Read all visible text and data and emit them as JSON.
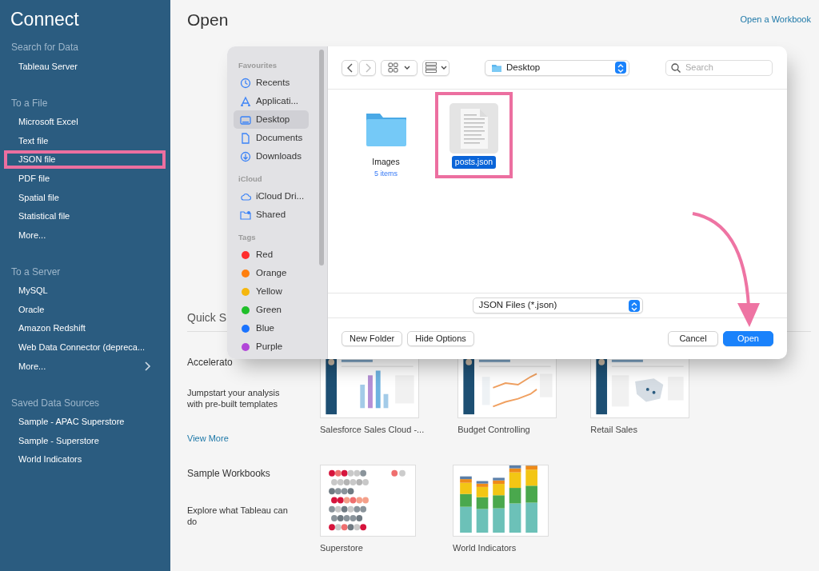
{
  "sidebar": {
    "title": "Connect",
    "sections": [
      {
        "heading": "Search for Data",
        "items": [
          {
            "label": "Tableau Server",
            "highlighted": false,
            "submenu": false
          }
        ]
      },
      {
        "heading": "To a File",
        "items": [
          {
            "label": "Microsoft Excel",
            "highlighted": false,
            "submenu": false
          },
          {
            "label": "Text file",
            "highlighted": false,
            "submenu": false
          },
          {
            "label": "JSON file",
            "highlighted": true,
            "submenu": false
          },
          {
            "label": "PDF file",
            "highlighted": false,
            "submenu": false
          },
          {
            "label": "Spatial file",
            "highlighted": false,
            "submenu": false
          },
          {
            "label": "Statistical file",
            "highlighted": false,
            "submenu": false
          },
          {
            "label": "More...",
            "highlighted": false,
            "submenu": false
          }
        ]
      },
      {
        "heading": "To a Server",
        "items": [
          {
            "label": "MySQL",
            "highlighted": false,
            "submenu": false
          },
          {
            "label": "Oracle",
            "highlighted": false,
            "submenu": false
          },
          {
            "label": "Amazon Redshift",
            "highlighted": false,
            "submenu": false
          },
          {
            "label": "Web Data Connector (depreca...",
            "highlighted": false,
            "submenu": false
          },
          {
            "label": "More...",
            "highlighted": false,
            "submenu": true
          }
        ]
      },
      {
        "heading": "Saved Data Sources",
        "items": [
          {
            "label": "Sample - APAC Superstore",
            "highlighted": false,
            "submenu": false
          },
          {
            "label": "Sample - Superstore",
            "highlighted": false,
            "submenu": false
          },
          {
            "label": "World Indicators",
            "highlighted": false,
            "submenu": false
          }
        ]
      }
    ]
  },
  "main": {
    "title": "Open",
    "link": "Open a Workbook",
    "quick_start_heading": "Quick S",
    "accelerators": {
      "heading": "Accelerato",
      "description": "Jumpstart your analysis with pre-built templates",
      "link": "View More",
      "items": [
        {
          "label": "Salesforce Sales Cloud -...",
          "kind": "picture"
        },
        {
          "label": "Budget Controlling",
          "kind": "picture"
        },
        {
          "label": "Retail Sales",
          "kind": "picture"
        }
      ]
    },
    "samples": {
      "heading": "Sample Workbooks",
      "description": "Explore what Tableau can do",
      "items": [
        {
          "label": "Superstore",
          "kind": "dot_plot"
        },
        {
          "label": "World Indicators",
          "kind": "stacked_bars"
        }
      ]
    }
  },
  "dialog": {
    "sidebar": {
      "sections": [
        {
          "heading": "Favourites",
          "items": [
            {
              "label": "Recents",
              "kind": "recents",
              "selected": false
            },
            {
              "label": "Applicati...",
              "kind": "applications",
              "selected": false
            },
            {
              "label": "Desktop",
              "kind": "desktop",
              "selected": true
            },
            {
              "label": "Documents",
              "kind": "documents",
              "selected": false
            },
            {
              "label": "Downloads",
              "kind": "downloads",
              "selected": false
            }
          ]
        },
        {
          "heading": "iCloud",
          "items": [
            {
              "label": "iCloud Dri...",
              "kind": "icloud",
              "selected": false
            },
            {
              "label": "Shared",
              "kind": "shared",
              "selected": false
            }
          ]
        },
        {
          "heading": "Tags",
          "items": [
            {
              "label": "Red",
              "kind": "tag",
              "selected": false,
              "color": "#ff2d2d"
            },
            {
              "label": "Orange",
              "kind": "tag",
              "selected": false,
              "color": "#ff7f0f"
            },
            {
              "label": "Yellow",
              "kind": "tag",
              "selected": false,
              "color": "#f5b70f"
            },
            {
              "label": "Green",
              "kind": "tag",
              "selected": false,
              "color": "#1fbf2a"
            },
            {
              "label": "Blue",
              "kind": "tag",
              "selected": false,
              "color": "#1a73ff"
            },
            {
              "label": "Purple",
              "kind": "tag",
              "selected": false,
              "color": "#b146d8"
            }
          ]
        }
      ]
    },
    "toolbar": {
      "location": "Desktop",
      "search_placeholder": "Search"
    },
    "files": [
      {
        "name": "Images",
        "detail": "5 items",
        "kind": "folder",
        "selected": false,
        "highlighted": false
      },
      {
        "name": "posts.json",
        "kind": "document",
        "selected": true,
        "highlighted": true
      }
    ],
    "filter": "JSON Files (*.json)",
    "buttons": [
      {
        "label": "New Folder",
        "kind": "default"
      },
      {
        "label": "Hide Options",
        "kind": "default"
      },
      {
        "label": "Cancel",
        "kind": "default"
      },
      {
        "label": "Open",
        "kind": "primary"
      }
    ]
  }
}
